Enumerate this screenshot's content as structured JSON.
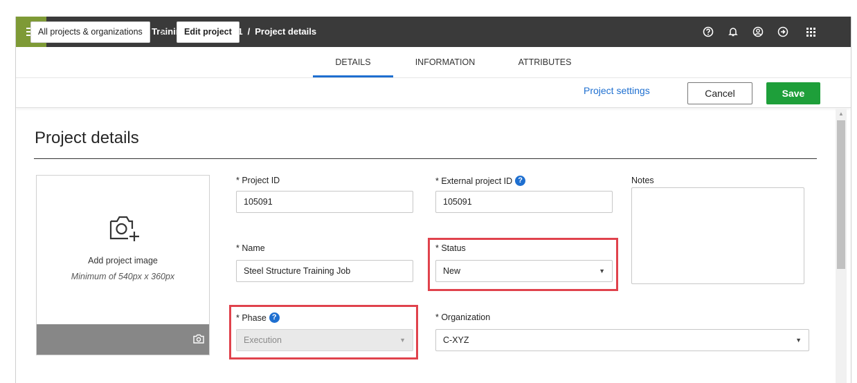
{
  "header": {
    "project_title": "Steel Structure Training Job | 105091",
    "separator": "/",
    "page": "Project details",
    "icons": [
      "menu-icon",
      "home-icon",
      "help-icon",
      "bell-icon",
      "user-icon",
      "logout-icon",
      "apps-grid-icon"
    ],
    "menu_color": "#7e9a36"
  },
  "breadcrumb": {
    "all_projects": "All projects & organizations",
    "chevron": ">",
    "edit_project": "Edit project"
  },
  "tabs": [
    "DETAILS",
    "INFORMATION",
    "ATTRIBUTES"
  ],
  "active_tab": "DETAILS",
  "actions": {
    "project_settings": "Project settings",
    "cancel": "Cancel",
    "save": "Save",
    "save_color": "#1e9f3a",
    "link_color": "#1e6fd0"
  },
  "page_title": "Project details",
  "image": {
    "add_label": "Add project image",
    "min_label": "Minimum of 540px x 360px"
  },
  "fields": {
    "project_id": {
      "label": "* Project ID",
      "value": "105091"
    },
    "external_id": {
      "label": "* External project ID",
      "value": "105091"
    },
    "notes": {
      "label": "Notes",
      "value": ""
    },
    "name": {
      "label": "* Name",
      "value": "Steel Structure Training Job"
    },
    "status": {
      "label": "* Status",
      "value": "New"
    },
    "phase": {
      "label": "* Phase",
      "value": "Execution"
    },
    "organization": {
      "label": "* Organization",
      "value": "C-XYZ"
    }
  },
  "highlight_color": "#e0424c"
}
